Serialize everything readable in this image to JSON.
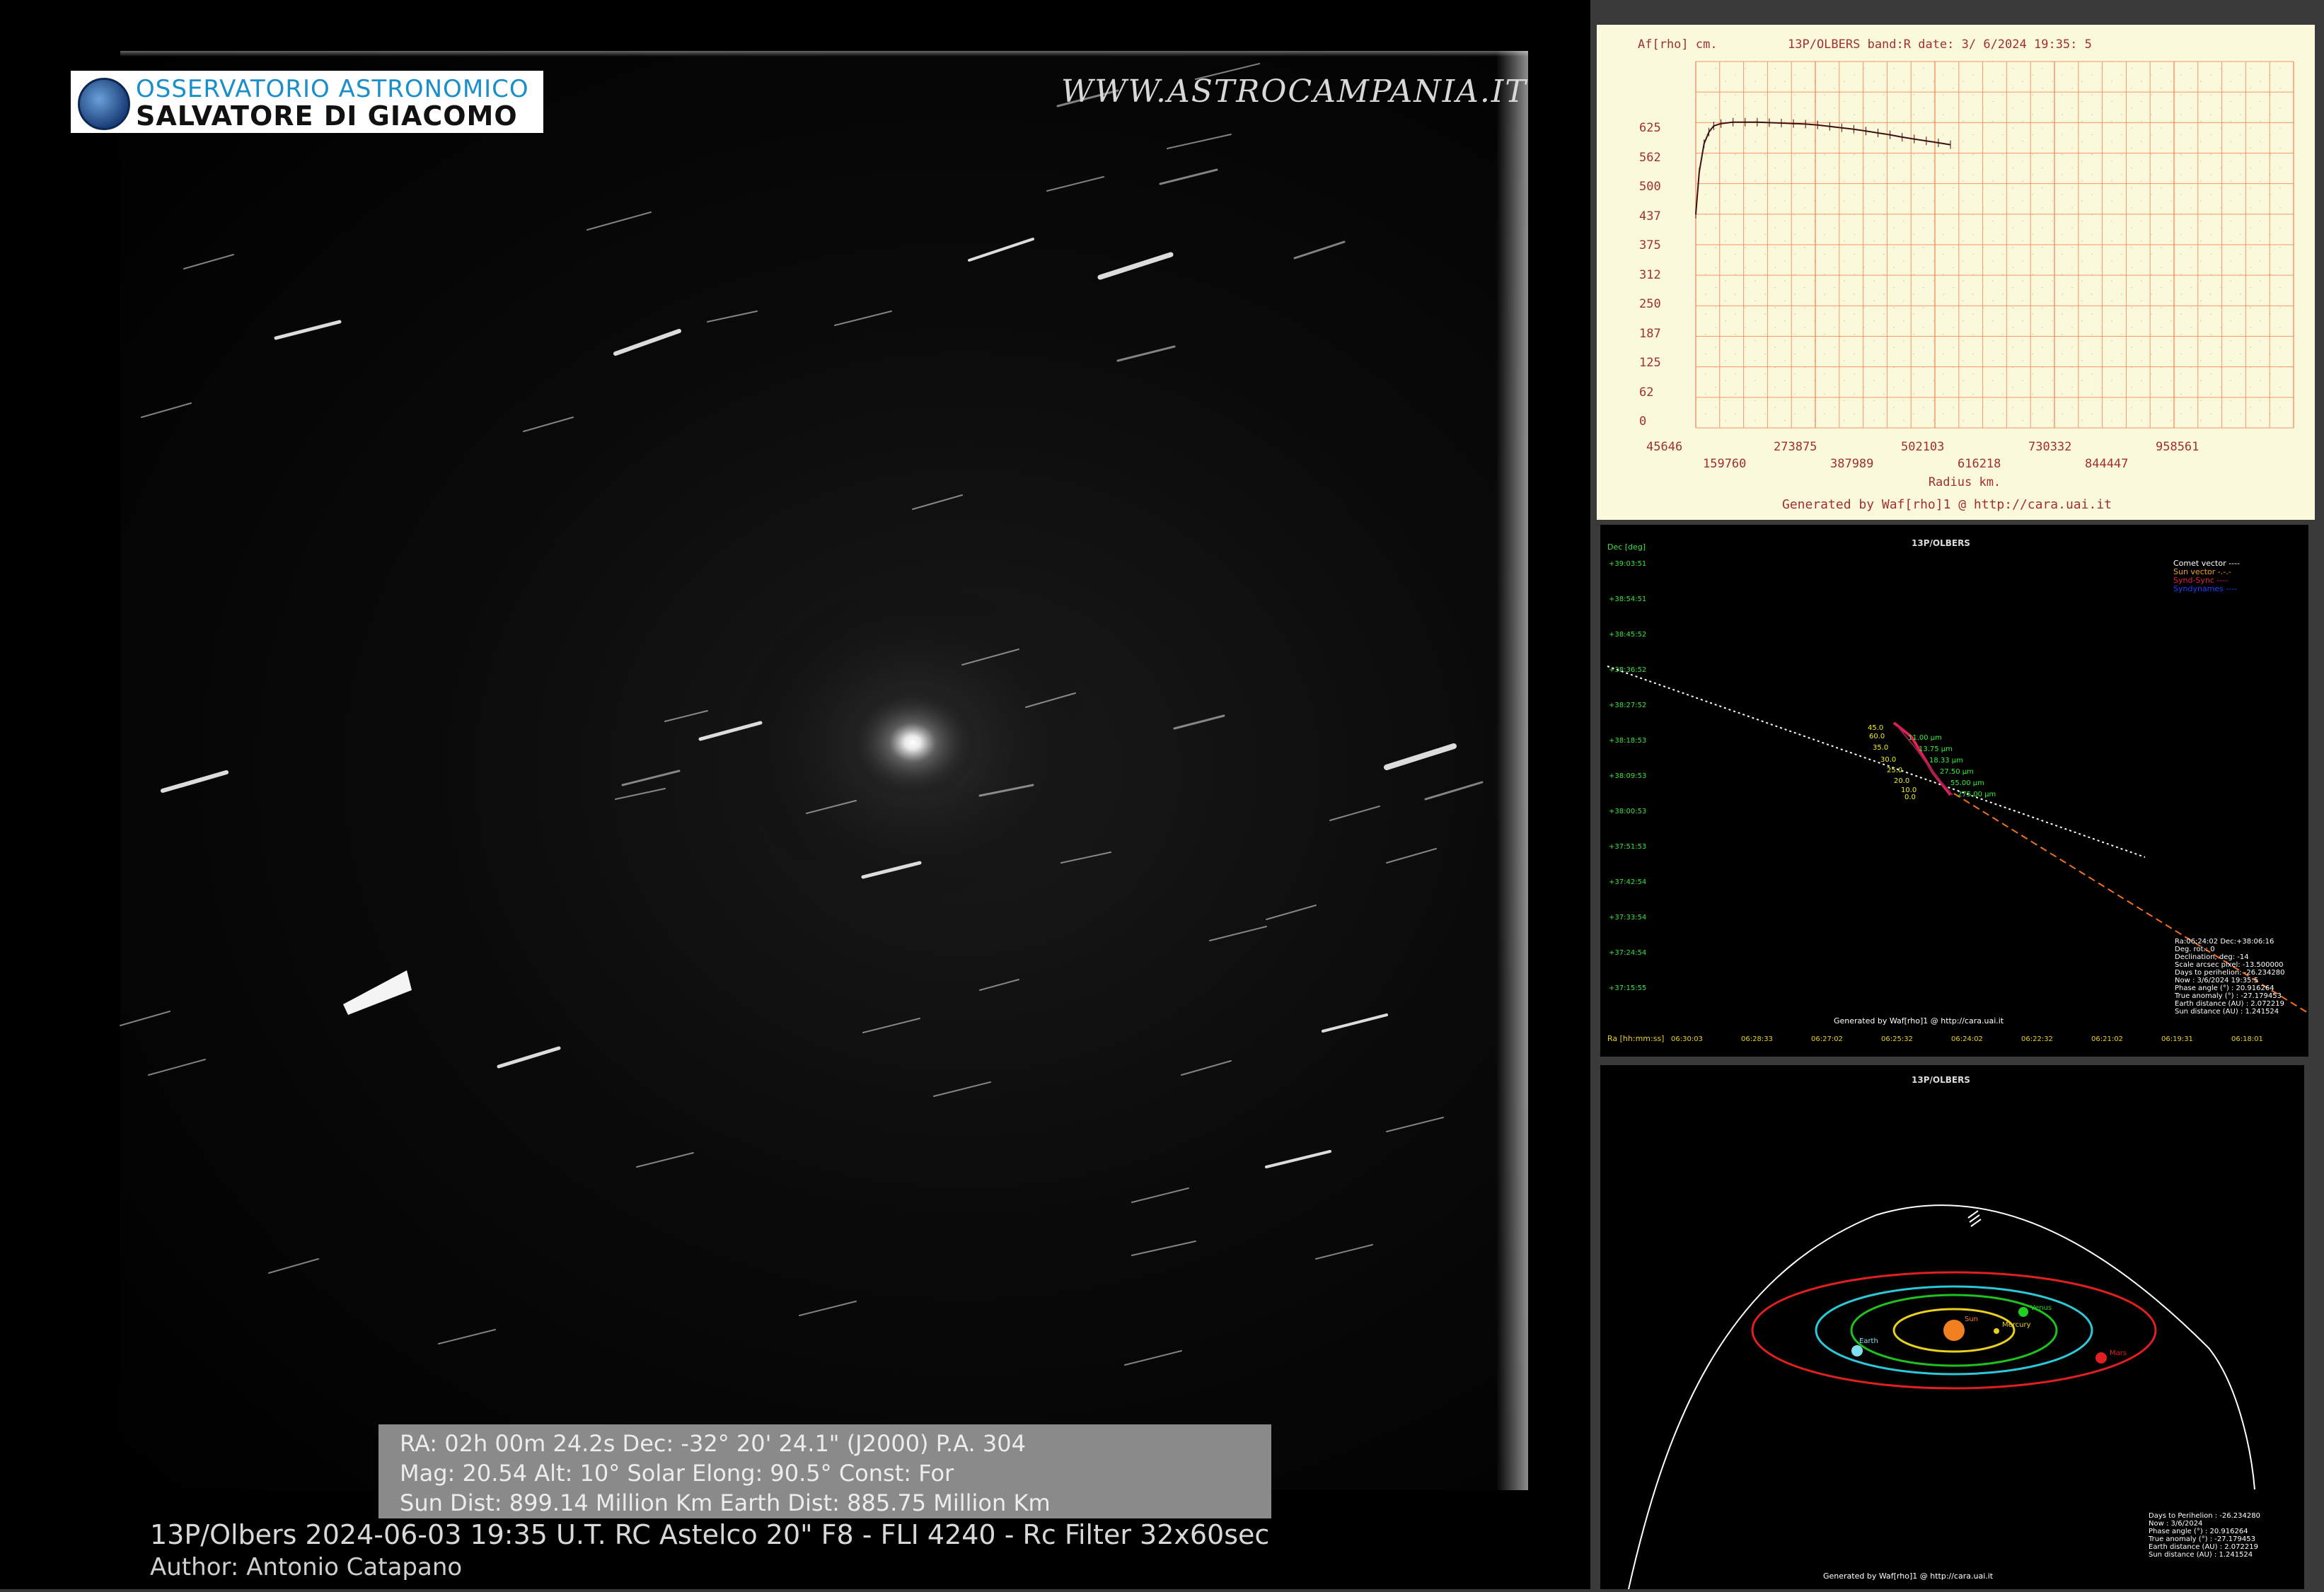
{
  "logo": {
    "line1": "OSSERVATORIO ASTRONOMICO",
    "line2": "SALVATORE DI GIACOMO"
  },
  "website": "WWW.ASTROCAMPANIA.IT",
  "info": {
    "line1": "RA: 02h 00m 24.2s    Dec:  -32° 20' 24.1\" (J2000)     P.A. 304",
    "line2": "Mag: 20.54 Alt: 10° Solar Elong: 90.5° Const: For",
    "line3": "Sun Dist: 899.14 Million Km    Earth Dist: 885.75 Million Km"
  },
  "caption": {
    "line1": "13P/Olbers  2024-06-03  19:35 U.T.  RC Astelco 20\" F8 - FLI 4240 - Rc Filter 32x60sec",
    "line2": "Author: Antonio Catapano"
  },
  "afrho": {
    "ylabel": "Af[rho] cm.",
    "header": "13P/OLBERS band:R date:  3/ 6/2024 19:35: 5",
    "yticks": [
      "625",
      "562",
      "500",
      "437",
      "375",
      "312",
      "250",
      "187",
      "125",
      "62",
      "0"
    ],
    "xticks_top": [
      "45646",
      "273875",
      "502103",
      "730332",
      "958561"
    ],
    "xticks_bottom": [
      "159760",
      "387989",
      "616218",
      "844447"
    ],
    "xlabel": "Radius km.",
    "footer": "Generated by Waf[rho]1 @ http://cara.uai.it",
    "colors": {
      "bg": "#fbf9db",
      "grid": "#f08050",
      "text": "#a03030",
      "curve": "#401010"
    }
  },
  "chart_data": {
    "type": "line",
    "title": "13P/OLBERS band:R date:  3/ 6/2024 19:35: 5",
    "xlabel": "Radius km.",
    "ylabel": "Af[rho] cm.",
    "ylim": [
      0,
      625
    ],
    "x": [
      45646,
      60000,
      80000,
      100000,
      120000,
      150000,
      200000,
      250000,
      300000,
      350000,
      400000,
      450000,
      500000,
      550000,
      600000,
      650000,
      700000,
      750000,
      800000,
      850000,
      900000,
      950000,
      1000000,
      1050000,
      1100000
    ],
    "y": [
      440,
      530,
      590,
      615,
      628,
      633,
      636,
      636,
      636,
      635,
      634,
      633,
      632,
      630,
      627,
      624,
      621,
      617,
      613,
      609,
      604,
      600,
      596,
      592,
      588
    ],
    "grid": true
  },
  "trajectory": {
    "title": "13P/OLBERS",
    "dec_label": "Dec [deg]",
    "dec_ticks": [
      "+39:03:51",
      "+38:54:51",
      "+38:45:52",
      "+38:36:52",
      "+38:27:52",
      "+38:18:53",
      "+38:09:53",
      "+38:00:53",
      "+37:51:53",
      "+37:42:54",
      "+37:33:54",
      "+37:24:54",
      "+37:15:55"
    ],
    "ra_label": "Ra [hh:mm:ss]",
    "ra_ticks": [
      "06:30:03",
      "06:28:33",
      "06:27:02",
      "06:25:32",
      "06:24:02",
      "06:22:32",
      "06:21:02",
      "06:19:31",
      "06:18:01"
    ],
    "legend": [
      "Comet vector ----",
      "Sun vector -.-.-",
      "Synd-Sync ----",
      "Syndynames ----"
    ],
    "syndyne_labels": [
      "45.0",
      "60.0",
      "35.0",
      "30.0",
      "25.0",
      "20.0",
      "10.0",
      "0.0"
    ],
    "size_labels": [
      "11.00 µm",
      "13.75 µm",
      "18.33 µm",
      "27.50 µm",
      "55.00 µm",
      "275.00 µm"
    ],
    "params": [
      "Ra:06:24:02 Dec:+38:06:16",
      "Deg. rot.:    0",
      "Declination, deg: -14",
      "Scale arcsec pixel: -13.500000",
      "Days to perihelion: -26.234280",
      "Now :  3/6/2024 19:35:5",
      "Phase angle (°) : 20.916264",
      "True anomaly (°) : -27.179453",
      "Earth distance (AU) : 2.072219",
      "Sun distance (AU) : 1.241524"
    ],
    "footer": "Generated by Waf[rho]1 @ http://cara.uai.it"
  },
  "orbit": {
    "title": "13P/OLBERS",
    "planets": [
      "Sun",
      "Mercury",
      "Venus",
      "Earth",
      "Mars"
    ],
    "params": [
      "Days to Perihelion : -26.234280",
      "Now : 3/6/2024",
      "Phase angle (°) : 20.916264",
      "True anomaly (°) : -27.179453",
      "Earth distance (AU) : 2.072219",
      "Sun distance (AU) : 1.241524"
    ],
    "footer": "Generated by Waf[rho]1 @ http://cara.uai.it"
  }
}
